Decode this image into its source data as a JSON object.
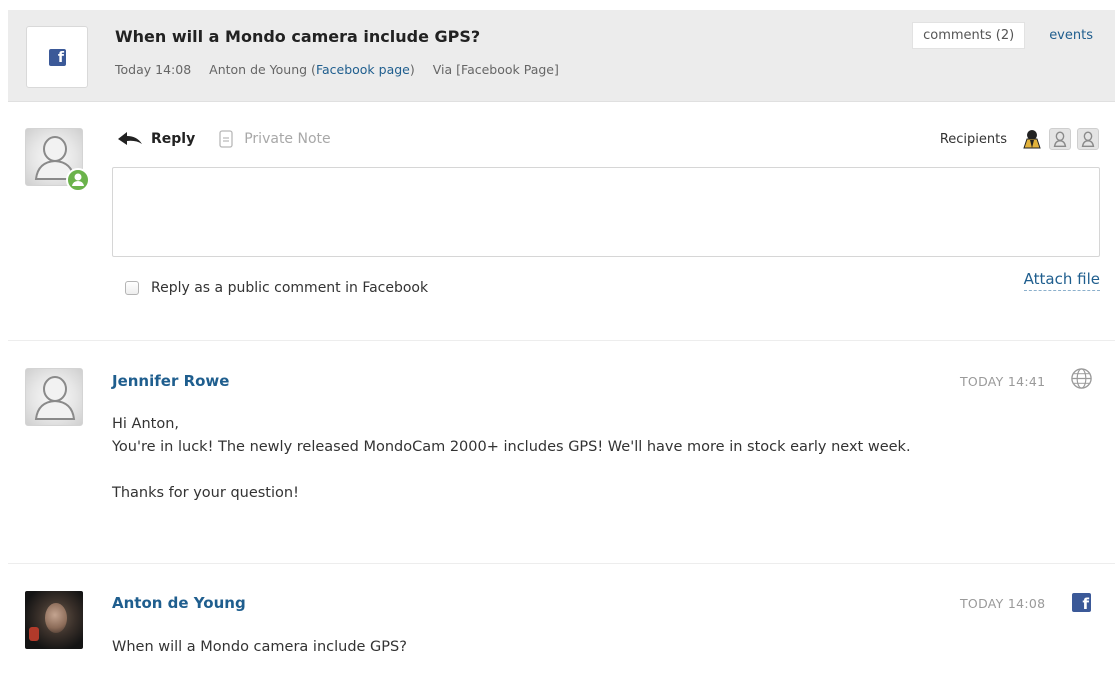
{
  "header": {
    "title": "When will a Mondo camera include GPS?",
    "time": "Today 14:08",
    "author": "Anton de Young",
    "source_link": "Facebook page",
    "via": "Via [Facebook Page]",
    "tabs": {
      "comments": "comments (2)",
      "events": "events"
    },
    "channel_icon": "facebook-icon"
  },
  "reply": {
    "reply_label": "Reply",
    "private_note_label": "Private Note",
    "recipients_label": "Recipients",
    "textarea_value": "",
    "public_comment_label": "Reply as a public comment in Facebook",
    "public_comment_checked": false,
    "attach_label": "Attach file"
  },
  "messages": [
    {
      "author": "Jennifer Rowe",
      "time": "TODAY 14:41",
      "channel_icon": "globe-icon",
      "lines": [
        "Hi Anton,",
        "You're in luck! The newly released MondoCam 2000+ includes GPS! We'll have more in stock early next week.",
        "",
        "Thanks for your question!"
      ]
    },
    {
      "author": "Anton de Young",
      "time": "TODAY 14:08",
      "channel_icon": "facebook-icon",
      "lines": [
        "When will a Mondo camera include GPS?"
      ]
    }
  ],
  "colors": {
    "link": "#1f5e8e",
    "facebook": "#3b5998",
    "presence": "#6bb34b",
    "header_bg": "#ececec"
  }
}
